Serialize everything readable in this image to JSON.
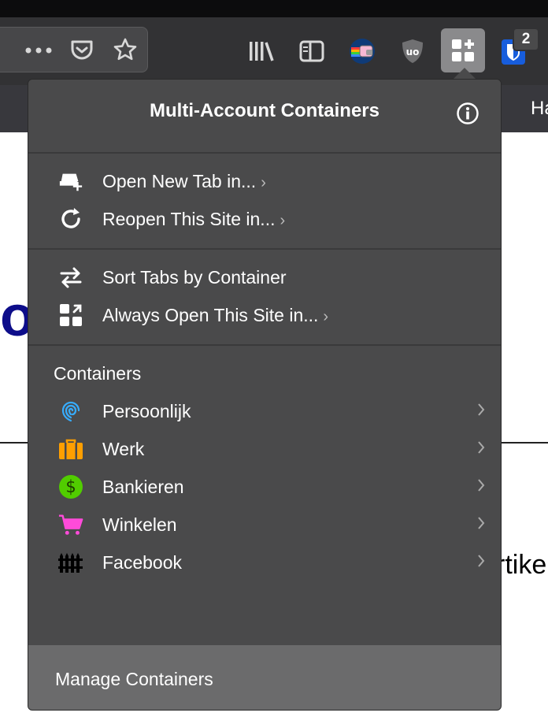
{
  "browser": {
    "nav_partial_text": "Ha",
    "page_partial_letter": "o",
    "page_partial_text": "rtike",
    "colors": {
      "toolbar_bg": "#323234",
      "popup_bg": "#4a4a4b",
      "accent_blue": "#1f6fd1"
    }
  },
  "toolbar": {
    "icons": [
      "more-dots-icon",
      "pocket-icon",
      "bookmark-star-icon",
      "library-icon",
      "sidebar-icon",
      "nyan-cat-icon",
      "ublock-icon",
      "containers-icon",
      "bitwarden-icon"
    ],
    "bitwarden_badge": "2"
  },
  "popup": {
    "title": "Multi-Account Containers",
    "actions": [
      {
        "label": "Open New Tab in...",
        "icon": "new-tab-icon",
        "chevron": true
      },
      {
        "label": "Reopen This Site in...",
        "icon": "reopen-icon",
        "chevron": true
      },
      {
        "label": "Sort Tabs by Container",
        "icon": "sort-arrows-icon",
        "chevron": false
      },
      {
        "label": "Always Open This Site in...",
        "icon": "always-open-icon",
        "chevron": true
      }
    ],
    "containers_heading": "Containers",
    "containers": [
      {
        "label": "Persoonlijk",
        "icon": "fingerprint-icon",
        "color": "#37adff"
      },
      {
        "label": "Werk",
        "icon": "briefcase-icon",
        "color": "#ff9f00"
      },
      {
        "label": "Bankieren",
        "icon": "dollar-icon",
        "color": "#51cd00"
      },
      {
        "label": "Winkelen",
        "icon": "cart-icon",
        "color": "#ff4bda"
      },
      {
        "label": "Facebook",
        "icon": "fence-icon",
        "color": "#000000"
      }
    ],
    "footer_label": "Manage Containers"
  }
}
